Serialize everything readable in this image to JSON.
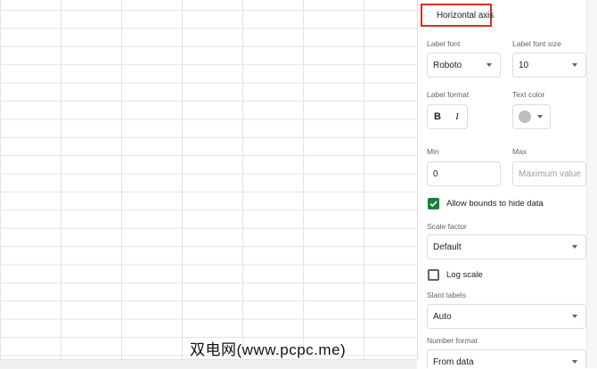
{
  "panel": {
    "section_title": "Horizontal axis",
    "label_font": {
      "label": "Label font",
      "value": "Roboto"
    },
    "label_font_size": {
      "label": "Label font size",
      "value": "10"
    },
    "label_format": {
      "label": "Label format",
      "bold": "B",
      "italic": "I"
    },
    "text_color": {
      "label": "Text color",
      "value": "#bdbdbd"
    },
    "min": {
      "label": "Min",
      "value": "0"
    },
    "max": {
      "label": "Max",
      "placeholder": "Maximum value"
    },
    "allow_bounds": {
      "label": "Allow bounds to hide data",
      "checked": true
    },
    "scale_factor": {
      "label": "Scale factor",
      "value": "Default"
    },
    "log_scale": {
      "label": "Log scale",
      "checked": false
    },
    "slant_labels": {
      "label": "Slant labels",
      "value": "Auto"
    },
    "number_format": {
      "label": "Number format",
      "value": "From data"
    }
  },
  "watermark": "双电网(www.pcpc.me)",
  "colors": {
    "accent_red": "#d93025",
    "checkbox_green": "#188038"
  },
  "icons": [
    "chevron-down-icon",
    "dropdown-caret-icon",
    "check-icon"
  ]
}
